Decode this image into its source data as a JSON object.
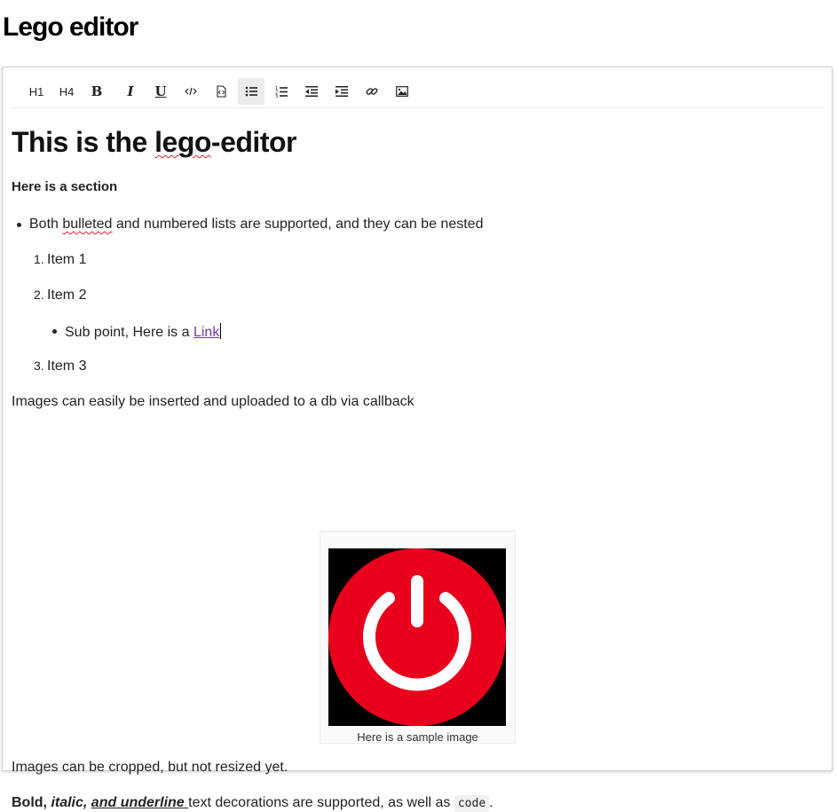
{
  "page": {
    "title": "Lego editor"
  },
  "toolbar": {
    "h1_label": "H1",
    "h4_label": "H4",
    "bold_label": "B",
    "italic_label": "I",
    "underline_label": "U",
    "buttons": [
      {
        "name": "code-icon"
      },
      {
        "name": "code-block-icon"
      },
      {
        "name": "bulleted-list-icon",
        "active": true
      },
      {
        "name": "numbered-list-icon"
      },
      {
        "name": "outdent-icon"
      },
      {
        "name": "indent-icon"
      },
      {
        "name": "link-icon"
      },
      {
        "name": "image-icon"
      }
    ]
  },
  "document": {
    "heading_pre": "This is the ",
    "heading_word": "lego",
    "heading_post": "-editor",
    "section_title": "Here is a section",
    "bullet_pre": "Both ",
    "bullet_word": "bulleted",
    "bullet_post": " and numbered lists are supported, and they can be nested",
    "items": [
      {
        "marker": "1.",
        "text": "Item 1"
      },
      {
        "marker": "2.",
        "text": "Item 2"
      },
      {
        "marker": "3.",
        "text": "Item 3"
      }
    ],
    "sub_point_text": "Sub point, Here is a ",
    "sub_point_link": "Link",
    "images_para": "Images can easily be inserted and uploaded to a db via callback",
    "image_caption": "Here is a sample image",
    "image_colors": {
      "background": "#000000",
      "circle": "#e8001c",
      "symbol": "#ffffff"
    },
    "crop_para": "Images can be cropped, but not resized yet.",
    "final_bold": "Bold, ",
    "final_italic": "italic, ",
    "final_underline": "and underline ",
    "final_text": "text decorations are supported, as well as ",
    "final_code": "code",
    "final_period": "."
  }
}
